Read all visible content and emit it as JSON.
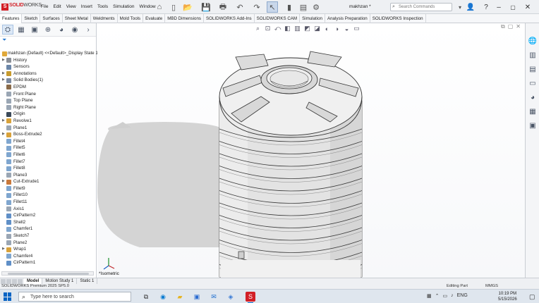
{
  "app": {
    "logo_bold": "SOLID",
    "logo_light": "WORKS",
    "document_title": "makhzan *"
  },
  "menu": [
    "File",
    "Edit",
    "View",
    "Insert",
    "Tools",
    "Simulation",
    "Window"
  ],
  "search": {
    "placeholder": "Search Commands"
  },
  "command_tabs": [
    "Features",
    "Sketch",
    "Surfaces",
    "Sheet Metal",
    "Weldments",
    "Mold Tools",
    "Evaluate",
    "MBD Dimensions",
    "SOLIDWORKS Add-Ins",
    "SOLIDWORKS CAM",
    "Simulation",
    "Analysis Preparation",
    "SOLIDWORKS Inspection"
  ],
  "active_command_tab": "Features",
  "feature_tree": {
    "root": "makhzan (Default) <<Default>_Display State 1",
    "items": [
      {
        "label": "History",
        "icon": "history-icon",
        "color": "#8a8f97",
        "expand": true
      },
      {
        "label": "Sensors",
        "icon": "sensor-icon",
        "color": "#6b86a8",
        "expand": false
      },
      {
        "label": "Annotations",
        "icon": "annotation-icon",
        "color": "#c89b2d",
        "expand": true
      },
      {
        "label": "Solid Bodies(1)",
        "icon": "solid-body-icon",
        "color": "#7c8aa0",
        "expand": true
      },
      {
        "label": "EPDM",
        "icon": "material-icon",
        "color": "#8a6b4a",
        "expand": false
      },
      {
        "label": "Front Plane",
        "icon": "plane-icon",
        "color": "#9aa6b4",
        "expand": false
      },
      {
        "label": "Top Plane",
        "icon": "plane-icon",
        "color": "#9aa6b4",
        "expand": false
      },
      {
        "label": "Right Plane",
        "icon": "plane-icon",
        "color": "#9aa6b4",
        "expand": false
      },
      {
        "label": "Origin",
        "icon": "origin-icon",
        "color": "#3c4a5a",
        "expand": false
      },
      {
        "label": "Revolve1",
        "icon": "revolve-icon",
        "color": "#d9a23a",
        "expand": true
      },
      {
        "label": "Plane1",
        "icon": "plane-icon",
        "color": "#9aa6b4",
        "expand": false
      },
      {
        "label": "Boss-Extrude2",
        "icon": "extrude-icon",
        "color": "#d9a23a",
        "expand": true
      },
      {
        "label": "Fillet4",
        "icon": "fillet-icon",
        "color": "#7fa6cf",
        "expand": false
      },
      {
        "label": "Fillet5",
        "icon": "fillet-icon",
        "color": "#7fa6cf",
        "expand": false
      },
      {
        "label": "Fillet6",
        "icon": "fillet-icon",
        "color": "#7fa6cf",
        "expand": false
      },
      {
        "label": "Fillet7",
        "icon": "fillet-icon",
        "color": "#7fa6cf",
        "expand": false
      },
      {
        "label": "Fillet8",
        "icon": "fillet-icon",
        "color": "#7fa6cf",
        "expand": false
      },
      {
        "label": "Plane3",
        "icon": "plane-icon",
        "color": "#9aa6b4",
        "expand": false
      },
      {
        "label": "Cut-Extrude1",
        "icon": "cut-extrude-icon",
        "color": "#c9783a",
        "expand": true
      },
      {
        "label": "Fillet9",
        "icon": "fillet-icon",
        "color": "#7fa6cf",
        "expand": false
      },
      {
        "label": "Fillet10",
        "icon": "fillet-icon",
        "color": "#7fa6cf",
        "expand": false
      },
      {
        "label": "Fillet11",
        "icon": "fillet-icon",
        "color": "#7fa6cf",
        "expand": false
      },
      {
        "label": "Axis1",
        "icon": "axis-icon",
        "color": "#9aa6b4",
        "expand": false
      },
      {
        "label": "CirPattern2",
        "icon": "circular-pattern-icon",
        "color": "#5f8fc7",
        "expand": false
      },
      {
        "label": "Shell2",
        "icon": "shell-icon",
        "color": "#5f8fc7",
        "expand": false
      },
      {
        "label": "Chamfer1",
        "icon": "chamfer-icon",
        "color": "#7fa6cf",
        "expand": false
      },
      {
        "label": "Sketch7",
        "icon": "sketch-icon",
        "color": "#9aa6b4",
        "expand": false
      },
      {
        "label": "Plane2",
        "icon": "plane-icon",
        "color": "#9aa6b4",
        "expand": false
      },
      {
        "label": "Wrap1",
        "icon": "wrap-icon",
        "color": "#d9a23a",
        "expand": true
      },
      {
        "label": "Chamfer4",
        "icon": "chamfer-icon",
        "color": "#7fa6cf",
        "expand": false
      },
      {
        "label": "CirPattern1",
        "icon": "circular-pattern-icon",
        "color": "#5f8fc7",
        "expand": false
      }
    ]
  },
  "viewport": {
    "view_label": "*Isometric",
    "model_color": "#e6e6e6",
    "shadow_color": "#d2d2d2"
  },
  "bottom_tabs": [
    "Model",
    "Motion Study 1",
    "Static 1"
  ],
  "active_bottom_tab": "Model",
  "status": {
    "left": "SOLIDWORKS Premium 2025 SP5.0",
    "mode": "Editing Part",
    "units": "MMGS"
  },
  "taskbar": {
    "search_placeholder": "Type here to search",
    "language": "ENG",
    "time": "10:19 PM",
    "date": "5/15/2026"
  }
}
